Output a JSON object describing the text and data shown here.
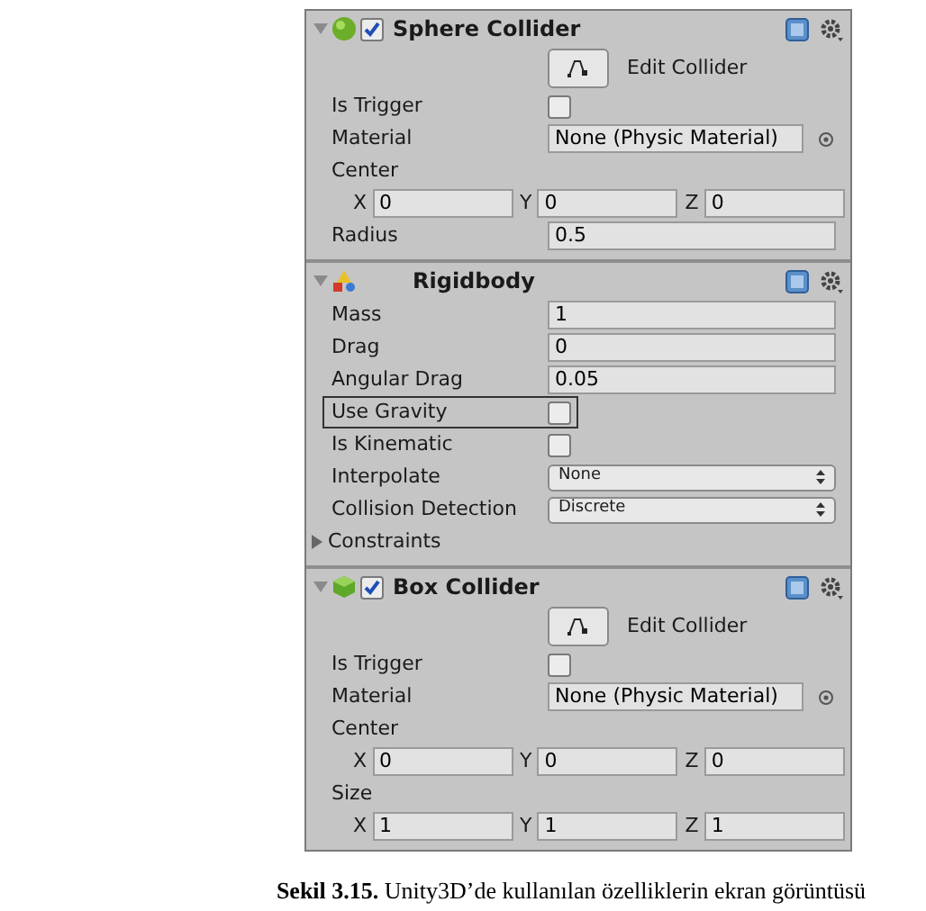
{
  "components": [
    {
      "title": "Sphere Collider",
      "kind": "sphere",
      "expanded": true,
      "enabled": true,
      "rows": [
        {
          "kind": "button",
          "label": "Edit Collider"
        },
        {
          "kind": "checkbox",
          "label": "Is Trigger",
          "checked": false,
          "focused": false
        },
        {
          "kind": "object",
          "label": "Material",
          "value": "None (Physic Material)"
        },
        {
          "kind": "vector",
          "label": "Center",
          "fields": [
            {
              "axis": "X",
              "value": "0"
            },
            {
              "axis": "Y",
              "value": "0"
            },
            {
              "axis": "Z",
              "value": "0"
            }
          ]
        },
        {
          "kind": "number",
          "label": "Radius",
          "value": "0.5"
        }
      ]
    },
    {
      "title": "Rigidbody",
      "kind": "rigidbody",
      "expanded": true,
      "rows": [
        {
          "kind": "number",
          "label": "Mass",
          "value": "1"
        },
        {
          "kind": "number",
          "label": "Drag",
          "value": "0"
        },
        {
          "kind": "number",
          "label": "Angular Drag",
          "value": "0.05"
        },
        {
          "kind": "checkbox",
          "label": "Use Gravity",
          "checked": false,
          "focused": true
        },
        {
          "kind": "checkbox",
          "label": "Is Kinematic",
          "checked": false,
          "focused": false
        },
        {
          "kind": "dropdown",
          "label": "Interpolate",
          "value": "None"
        },
        {
          "kind": "dropdown",
          "label": "Collision Detection",
          "value": "Discrete"
        },
        {
          "kind": "foldout",
          "label": "Constraints",
          "expanded": false
        }
      ]
    },
    {
      "title": "Box Collider",
      "kind": "box",
      "expanded": true,
      "enabled": true,
      "rows": [
        {
          "kind": "button",
          "label": "Edit Collider"
        },
        {
          "kind": "checkbox",
          "label": "Is Trigger",
          "checked": false,
          "focused": false
        },
        {
          "kind": "object",
          "label": "Material",
          "value": "None (Physic Material)"
        },
        {
          "kind": "vector",
          "label": "Center",
          "fields": [
            {
              "axis": "X",
              "value": "0"
            },
            {
              "axis": "Y",
              "value": "0"
            },
            {
              "axis": "Z",
              "value": "0"
            }
          ]
        },
        {
          "kind": "vector",
          "label": "Size",
          "fields": [
            {
              "axis": "X",
              "value": "1"
            },
            {
              "axis": "Y",
              "value": "1"
            },
            {
              "axis": "Z",
              "value": "1"
            }
          ]
        }
      ]
    }
  ],
  "caption": "**Sekil 3.15.** Unity3D’de kullanılan özelliklerin ekran görüntüsü"
}
